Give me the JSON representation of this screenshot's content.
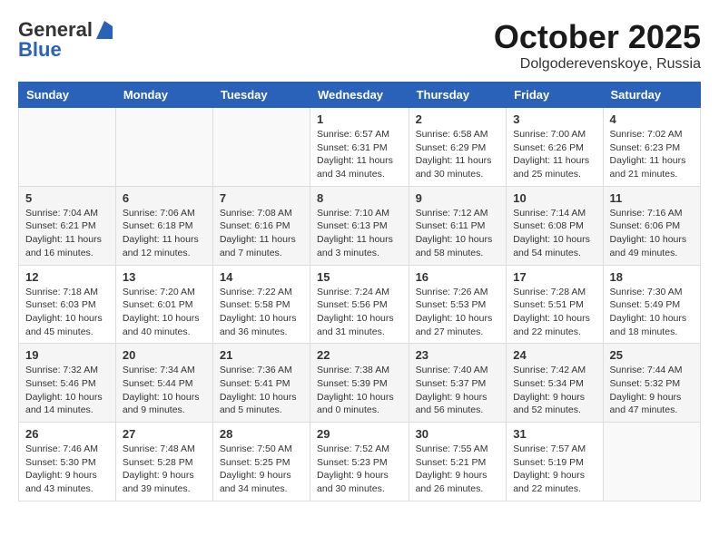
{
  "header": {
    "logo_general": "General",
    "logo_blue": "Blue",
    "month_title": "October 2025",
    "location": "Dolgoderevenskoye, Russia"
  },
  "weekdays": [
    "Sunday",
    "Monday",
    "Tuesday",
    "Wednesday",
    "Thursday",
    "Friday",
    "Saturday"
  ],
  "weeks": [
    [
      {
        "day": "",
        "info": ""
      },
      {
        "day": "",
        "info": ""
      },
      {
        "day": "",
        "info": ""
      },
      {
        "day": "1",
        "info": "Sunrise: 6:57 AM\nSunset: 6:31 PM\nDaylight: 11 hours\nand 34 minutes."
      },
      {
        "day": "2",
        "info": "Sunrise: 6:58 AM\nSunset: 6:29 PM\nDaylight: 11 hours\nand 30 minutes."
      },
      {
        "day": "3",
        "info": "Sunrise: 7:00 AM\nSunset: 6:26 PM\nDaylight: 11 hours\nand 25 minutes."
      },
      {
        "day": "4",
        "info": "Sunrise: 7:02 AM\nSunset: 6:23 PM\nDaylight: 11 hours\nand 21 minutes."
      }
    ],
    [
      {
        "day": "5",
        "info": "Sunrise: 7:04 AM\nSunset: 6:21 PM\nDaylight: 11 hours\nand 16 minutes."
      },
      {
        "day": "6",
        "info": "Sunrise: 7:06 AM\nSunset: 6:18 PM\nDaylight: 11 hours\nand 12 minutes."
      },
      {
        "day": "7",
        "info": "Sunrise: 7:08 AM\nSunset: 6:16 PM\nDaylight: 11 hours\nand 7 minutes."
      },
      {
        "day": "8",
        "info": "Sunrise: 7:10 AM\nSunset: 6:13 PM\nDaylight: 11 hours\nand 3 minutes."
      },
      {
        "day": "9",
        "info": "Sunrise: 7:12 AM\nSunset: 6:11 PM\nDaylight: 10 hours\nand 58 minutes."
      },
      {
        "day": "10",
        "info": "Sunrise: 7:14 AM\nSunset: 6:08 PM\nDaylight: 10 hours\nand 54 minutes."
      },
      {
        "day": "11",
        "info": "Sunrise: 7:16 AM\nSunset: 6:06 PM\nDaylight: 10 hours\nand 49 minutes."
      }
    ],
    [
      {
        "day": "12",
        "info": "Sunrise: 7:18 AM\nSunset: 6:03 PM\nDaylight: 10 hours\nand 45 minutes."
      },
      {
        "day": "13",
        "info": "Sunrise: 7:20 AM\nSunset: 6:01 PM\nDaylight: 10 hours\nand 40 minutes."
      },
      {
        "day": "14",
        "info": "Sunrise: 7:22 AM\nSunset: 5:58 PM\nDaylight: 10 hours\nand 36 minutes."
      },
      {
        "day": "15",
        "info": "Sunrise: 7:24 AM\nSunset: 5:56 PM\nDaylight: 10 hours\nand 31 minutes."
      },
      {
        "day": "16",
        "info": "Sunrise: 7:26 AM\nSunset: 5:53 PM\nDaylight: 10 hours\nand 27 minutes."
      },
      {
        "day": "17",
        "info": "Sunrise: 7:28 AM\nSunset: 5:51 PM\nDaylight: 10 hours\nand 22 minutes."
      },
      {
        "day": "18",
        "info": "Sunrise: 7:30 AM\nSunset: 5:49 PM\nDaylight: 10 hours\nand 18 minutes."
      }
    ],
    [
      {
        "day": "19",
        "info": "Sunrise: 7:32 AM\nSunset: 5:46 PM\nDaylight: 10 hours\nand 14 minutes."
      },
      {
        "day": "20",
        "info": "Sunrise: 7:34 AM\nSunset: 5:44 PM\nDaylight: 10 hours\nand 9 minutes."
      },
      {
        "day": "21",
        "info": "Sunrise: 7:36 AM\nSunset: 5:41 PM\nDaylight: 10 hours\nand 5 minutes."
      },
      {
        "day": "22",
        "info": "Sunrise: 7:38 AM\nSunset: 5:39 PM\nDaylight: 10 hours\nand 0 minutes."
      },
      {
        "day": "23",
        "info": "Sunrise: 7:40 AM\nSunset: 5:37 PM\nDaylight: 9 hours\nand 56 minutes."
      },
      {
        "day": "24",
        "info": "Sunrise: 7:42 AM\nSunset: 5:34 PM\nDaylight: 9 hours\nand 52 minutes."
      },
      {
        "day": "25",
        "info": "Sunrise: 7:44 AM\nSunset: 5:32 PM\nDaylight: 9 hours\nand 47 minutes."
      }
    ],
    [
      {
        "day": "26",
        "info": "Sunrise: 7:46 AM\nSunset: 5:30 PM\nDaylight: 9 hours\nand 43 minutes."
      },
      {
        "day": "27",
        "info": "Sunrise: 7:48 AM\nSunset: 5:28 PM\nDaylight: 9 hours\nand 39 minutes."
      },
      {
        "day": "28",
        "info": "Sunrise: 7:50 AM\nSunset: 5:25 PM\nDaylight: 9 hours\nand 34 minutes."
      },
      {
        "day": "29",
        "info": "Sunrise: 7:52 AM\nSunset: 5:23 PM\nDaylight: 9 hours\nand 30 minutes."
      },
      {
        "day": "30",
        "info": "Sunrise: 7:55 AM\nSunset: 5:21 PM\nDaylight: 9 hours\nand 26 minutes."
      },
      {
        "day": "31",
        "info": "Sunrise: 7:57 AM\nSunset: 5:19 PM\nDaylight: 9 hours\nand 22 minutes."
      },
      {
        "day": "",
        "info": ""
      }
    ]
  ]
}
